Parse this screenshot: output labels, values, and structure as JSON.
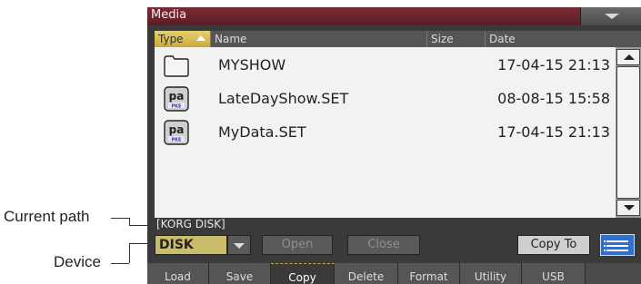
{
  "callouts": {
    "current_path": "Current path",
    "device": "Device"
  },
  "window": {
    "title": "Media"
  },
  "list": {
    "columns": [
      "Type",
      "Name",
      "Size",
      "Date"
    ],
    "rows": [
      {
        "type_icon": "folder-icon",
        "name": "MYSHOW",
        "size": "",
        "date": "17-04-15 21:13"
      },
      {
        "type_icon": "pa-set-icon",
        "name": "LateDayShow.SET",
        "size": "",
        "date": "08-08-15 15:58"
      },
      {
        "type_icon": "pa-set-icon",
        "name": "MyData.SET",
        "size": "",
        "date": "17-04-15 21:13"
      }
    ]
  },
  "path": "[KORG DISK]",
  "device": {
    "value": "DISK"
  },
  "buttons": {
    "open": "Open",
    "close": "Close",
    "copy_to": "Copy To"
  },
  "tabs": [
    "Load",
    "Save",
    "Copy",
    "Delete",
    "Format",
    "Utility",
    "USB"
  ],
  "active_tab": "Copy",
  "colors": {
    "title_bar": "#6a2430",
    "selected_column": "#c9a93a",
    "device_field": "#c9bc6a",
    "list_button": "#2f6fd0"
  }
}
